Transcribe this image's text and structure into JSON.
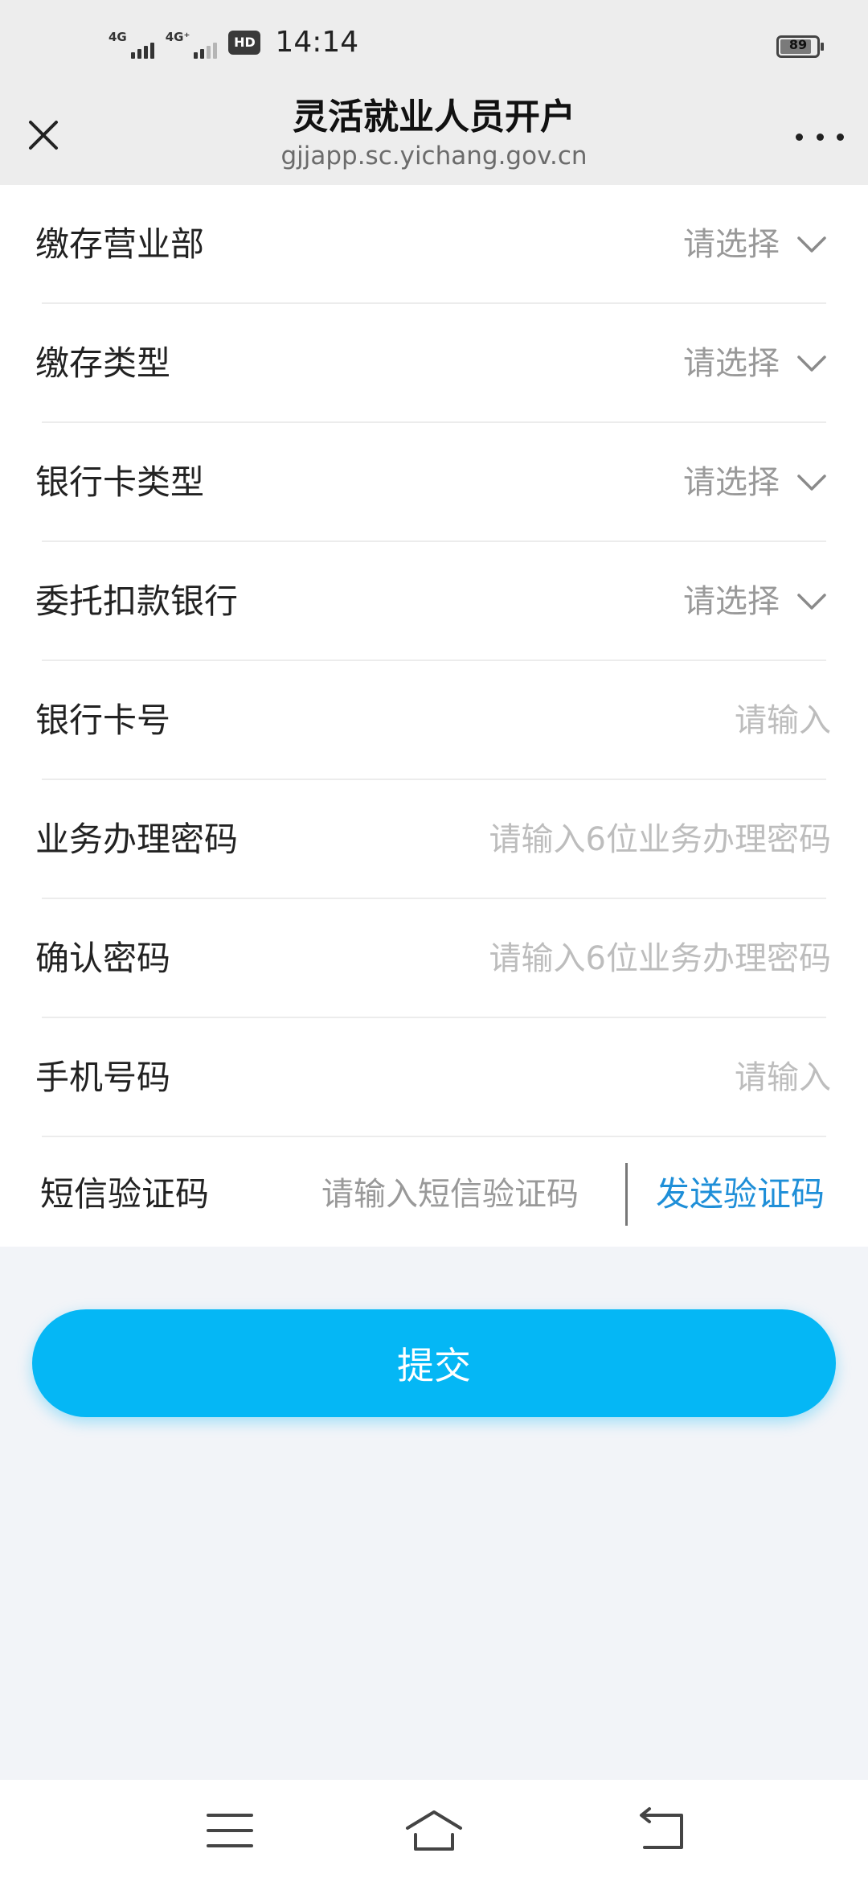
{
  "status_bar": {
    "network1": "4G",
    "network2": "4G⁺",
    "hd_badge": "HD",
    "time": "14:14",
    "battery": "89"
  },
  "header": {
    "title": "灵活就业人员开户",
    "url": "gjjapp.sc.yichang.gov.cn",
    "close_icon": "close-icon",
    "more_icon": "more-dots-icon"
  },
  "form": {
    "selects": [
      {
        "label": "缴存营业部",
        "value": "请选择"
      },
      {
        "label": "缴存类型",
        "value": "请选择"
      },
      {
        "label": "银行卡类型",
        "value": "请选择"
      },
      {
        "label": "委托扣款银行",
        "value": "请选择"
      }
    ],
    "inputs": [
      {
        "label": "银行卡号",
        "placeholder": "请输入"
      },
      {
        "label": "业务办理密码",
        "placeholder": "请输入6位业务办理密码"
      },
      {
        "label": "确认密码",
        "placeholder": "请输入6位业务办理密码"
      },
      {
        "label": "手机号码",
        "placeholder": "请输入"
      }
    ],
    "sms": {
      "label": "短信验证码",
      "placeholder": "请输入短信验证码",
      "send_label": "发送验证码"
    }
  },
  "submit_label": "提交",
  "colors": {
    "accent": "#05b7f5",
    "link": "#1f8fd8",
    "header_bg": "#ededed",
    "page_bg": "#f2f4f8"
  },
  "nav": {
    "menu_icon": "menu-icon",
    "home_icon": "home-icon",
    "back_icon": "back-icon"
  }
}
